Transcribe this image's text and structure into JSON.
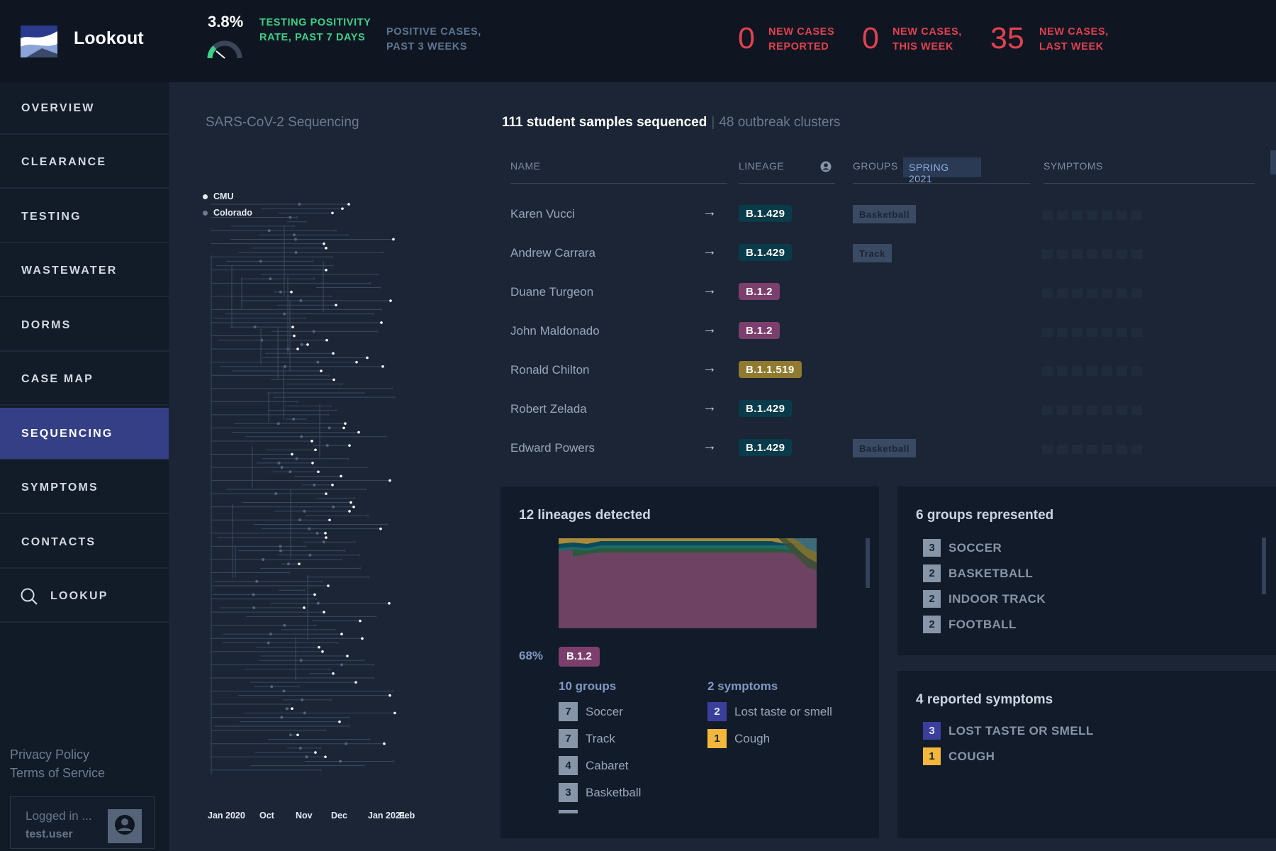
{
  "app": {
    "name": "Lookout"
  },
  "header": {
    "positivity_value": "3.8%",
    "positivity_label": "Testing positivity rate, past 7 days",
    "positive_cases_label": "Positive cases, past 3 weeks",
    "stats": [
      {
        "value": "0",
        "label": "New cases reported"
      },
      {
        "value": "0",
        "label": "New cases, this week"
      },
      {
        "value": "35",
        "label": "New cases, last week"
      }
    ]
  },
  "sidebar": {
    "items": [
      {
        "label": "Overview"
      },
      {
        "label": "Clearance"
      },
      {
        "label": "Testing"
      },
      {
        "label": "Wastewater"
      },
      {
        "label": "Dorms"
      },
      {
        "label": "Case Map"
      },
      {
        "label": "Sequencing",
        "active": true
      },
      {
        "label": "Symptoms"
      },
      {
        "label": "Contacts"
      },
      {
        "label": "Lookup",
        "icon": "search-icon"
      }
    ],
    "privacy": "Privacy Policy",
    "terms": "Terms of Service",
    "logged_in": "Logged in ...",
    "username": "test.user"
  },
  "sequencing": {
    "title": "SARS-CoV-2 Sequencing",
    "legend": [
      "CMU",
      "Colorado"
    ],
    "axis_labels": [
      "Jan 2020",
      "Oct",
      "Nov",
      "Dec",
      "Jan 2021",
      "Feb"
    ]
  },
  "samples": {
    "count_text": "111 student samples sequenced",
    "clusters_text": "48 outbreak clusters",
    "columns": {
      "name": "Name",
      "lineage": "Lineage",
      "groups": "Groups",
      "season": "Spring 2021",
      "symptoms": "Symptoms"
    },
    "rows": [
      {
        "name": "Karen Vucci",
        "lineage": "B.1.429",
        "lineage_color": "teal",
        "group": "Basketball"
      },
      {
        "name": "Andrew Carrara",
        "lineage": "B.1.429",
        "lineage_color": "teal",
        "group": "Track"
      },
      {
        "name": "Duane Turgeon",
        "lineage": "B.1.2",
        "lineage_color": "purple",
        "group": ""
      },
      {
        "name": "John Maldonado",
        "lineage": "B.1.2",
        "lineage_color": "purple",
        "group": ""
      },
      {
        "name": "Ronald Chilton",
        "lineage": "B.1.1.519",
        "lineage_color": "gold",
        "group": ""
      },
      {
        "name": "Robert Zelada",
        "lineage": "B.1.429",
        "lineage_color": "teal",
        "group": ""
      },
      {
        "name": "Edward Powers",
        "lineage": "B.1.429",
        "lineage_color": "teal",
        "group": "Basketball"
      }
    ]
  },
  "lineages": {
    "title": "12 lineages detected",
    "top_pct": "68%",
    "top_lineage": "B.1.2",
    "groups_head": "10 groups",
    "groups": [
      {
        "count": "7",
        "label": "Soccer"
      },
      {
        "count": "7",
        "label": "Track"
      },
      {
        "count": "4",
        "label": "Cabaret"
      },
      {
        "count": "3",
        "label": "Basketball"
      }
    ],
    "symptoms_head": "2 symptoms",
    "symptoms": [
      {
        "count": "2",
        "label": "Lost taste or smell"
      },
      {
        "count": "1",
        "label": "Cough"
      }
    ]
  },
  "groups_card": {
    "title": "6 groups represented",
    "items": [
      {
        "count": "3",
        "label": "Soccer"
      },
      {
        "count": "2",
        "label": "Basketball"
      },
      {
        "count": "2",
        "label": "Indoor Track"
      },
      {
        "count": "2",
        "label": "Football"
      }
    ]
  },
  "symptoms_card": {
    "title": "4 reported symptoms",
    "items": [
      {
        "count": "3",
        "label": "Lost taste or smell"
      },
      {
        "count": "1",
        "label": "Cough"
      }
    ]
  },
  "colors": {
    "accent": "#353f86",
    "alert": "#e0424f",
    "positive": "#3fcf87",
    "lineage_purple": "#7c3f6d",
    "lineage_teal": "#0a3b4a",
    "lineage_gold": "#8f7a30"
  }
}
